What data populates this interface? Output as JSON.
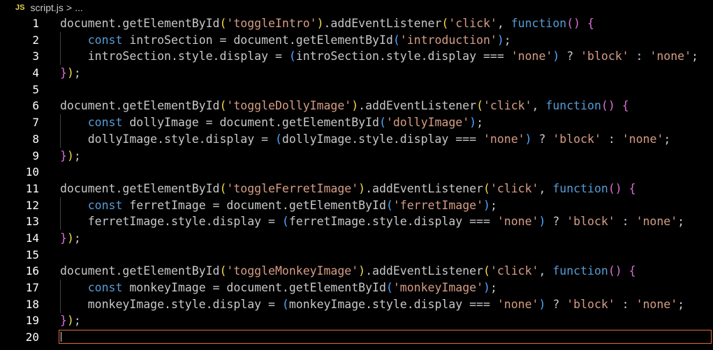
{
  "breadcrumb": {
    "badge": "JS",
    "file": "script.js",
    "separator": ">",
    "more": "..."
  },
  "colors": {
    "background": "#000000",
    "default_text": "#c8c8c8",
    "string": "#d69d85",
    "keyword": "#569cd6",
    "bracket_level_1": "#f5d94a",
    "bracket_level_2": "#da70d6",
    "bracket_level_3": "#4fa6ff",
    "current_line_border": "#e06c3b"
  },
  "editor": {
    "current_line": 20,
    "lines": [
      {
        "n": "1",
        "tokens": [
          {
            "t": "document.getElementById",
            "c": "def"
          },
          {
            "t": "(",
            "c": "p1"
          },
          {
            "t": "'toggleIntro'",
            "c": "str"
          },
          {
            "t": ")",
            "c": "p1"
          },
          {
            "t": ".addEventListener",
            "c": "def"
          },
          {
            "t": "(",
            "c": "p1"
          },
          {
            "t": "'click'",
            "c": "str"
          },
          {
            "t": ", ",
            "c": "def"
          },
          {
            "t": "function",
            "c": "key"
          },
          {
            "t": "()",
            "c": "p2"
          },
          {
            "t": " ",
            "c": "def"
          },
          {
            "t": "{",
            "c": "p2"
          }
        ]
      },
      {
        "n": "2",
        "tokens": [
          {
            "t": "    ",
            "c": "def"
          },
          {
            "t": "const",
            "c": "key"
          },
          {
            "t": " introSection = document.getElementById",
            "c": "def"
          },
          {
            "t": "(",
            "c": "p3"
          },
          {
            "t": "'introduction'",
            "c": "str"
          },
          {
            "t": ")",
            "c": "p3"
          },
          {
            "t": ";",
            "c": "def"
          }
        ]
      },
      {
        "n": "3",
        "tokens": [
          {
            "t": "    introSection.style.display = ",
            "c": "def"
          },
          {
            "t": "(",
            "c": "p3"
          },
          {
            "t": "introSection.style.display === ",
            "c": "def"
          },
          {
            "t": "'none'",
            "c": "str"
          },
          {
            "t": ")",
            "c": "p3"
          },
          {
            "t": " ? ",
            "c": "def"
          },
          {
            "t": "'block'",
            "c": "str"
          },
          {
            "t": " : ",
            "c": "def"
          },
          {
            "t": "'none'",
            "c": "str"
          },
          {
            "t": ";",
            "c": "def"
          }
        ]
      },
      {
        "n": "4",
        "tokens": [
          {
            "t": "}",
            "c": "p2"
          },
          {
            "t": ")",
            "c": "p1"
          },
          {
            "t": ";",
            "c": "def"
          }
        ]
      },
      {
        "n": "5",
        "tokens": []
      },
      {
        "n": "6",
        "tokens": [
          {
            "t": "document.getElementById",
            "c": "def"
          },
          {
            "t": "(",
            "c": "p1"
          },
          {
            "t": "'toggleDollyImage'",
            "c": "str"
          },
          {
            "t": ")",
            "c": "p1"
          },
          {
            "t": ".addEventListener",
            "c": "def"
          },
          {
            "t": "(",
            "c": "p1"
          },
          {
            "t": "'click'",
            "c": "str"
          },
          {
            "t": ", ",
            "c": "def"
          },
          {
            "t": "function",
            "c": "key"
          },
          {
            "t": "()",
            "c": "p2"
          },
          {
            "t": " ",
            "c": "def"
          },
          {
            "t": "{",
            "c": "p2"
          }
        ]
      },
      {
        "n": "7",
        "tokens": [
          {
            "t": "    ",
            "c": "def"
          },
          {
            "t": "const",
            "c": "key"
          },
          {
            "t": " dollyImage = document.getElementById",
            "c": "def"
          },
          {
            "t": "(",
            "c": "p3"
          },
          {
            "t": "'dollyImage'",
            "c": "str"
          },
          {
            "t": ")",
            "c": "p3"
          },
          {
            "t": ";",
            "c": "def"
          }
        ]
      },
      {
        "n": "8",
        "tokens": [
          {
            "t": "    dollyImage.style.display = ",
            "c": "def"
          },
          {
            "t": "(",
            "c": "p3"
          },
          {
            "t": "dollyImage.style.display === ",
            "c": "def"
          },
          {
            "t": "'none'",
            "c": "str"
          },
          {
            "t": ")",
            "c": "p3"
          },
          {
            "t": " ? ",
            "c": "def"
          },
          {
            "t": "'block'",
            "c": "str"
          },
          {
            "t": " : ",
            "c": "def"
          },
          {
            "t": "'none'",
            "c": "str"
          },
          {
            "t": ";",
            "c": "def"
          }
        ]
      },
      {
        "n": "9",
        "tokens": [
          {
            "t": "}",
            "c": "p2"
          },
          {
            "t": ")",
            "c": "p1"
          },
          {
            "t": ";",
            "c": "def"
          }
        ]
      },
      {
        "n": "10",
        "tokens": []
      },
      {
        "n": "11",
        "tokens": [
          {
            "t": "document.getElementById",
            "c": "def"
          },
          {
            "t": "(",
            "c": "p1"
          },
          {
            "t": "'toggleFerretImage'",
            "c": "str"
          },
          {
            "t": ")",
            "c": "p1"
          },
          {
            "t": ".addEventListener",
            "c": "def"
          },
          {
            "t": "(",
            "c": "p1"
          },
          {
            "t": "'click'",
            "c": "str"
          },
          {
            "t": ", ",
            "c": "def"
          },
          {
            "t": "function",
            "c": "key"
          },
          {
            "t": "()",
            "c": "p2"
          },
          {
            "t": " ",
            "c": "def"
          },
          {
            "t": "{",
            "c": "p2"
          }
        ]
      },
      {
        "n": "12",
        "tokens": [
          {
            "t": "    ",
            "c": "def"
          },
          {
            "t": "const",
            "c": "key"
          },
          {
            "t": " ferretImage = document.getElementById",
            "c": "def"
          },
          {
            "t": "(",
            "c": "p3"
          },
          {
            "t": "'ferretImage'",
            "c": "str"
          },
          {
            "t": ")",
            "c": "p3"
          },
          {
            "t": ";",
            "c": "def"
          }
        ]
      },
      {
        "n": "13",
        "tokens": [
          {
            "t": "    ferretImage.style.display = ",
            "c": "def"
          },
          {
            "t": "(",
            "c": "p3"
          },
          {
            "t": "ferretImage.style.display === ",
            "c": "def"
          },
          {
            "t": "'none'",
            "c": "str"
          },
          {
            "t": ")",
            "c": "p3"
          },
          {
            "t": " ? ",
            "c": "def"
          },
          {
            "t": "'block'",
            "c": "str"
          },
          {
            "t": " : ",
            "c": "def"
          },
          {
            "t": "'none'",
            "c": "str"
          },
          {
            "t": ";",
            "c": "def"
          }
        ]
      },
      {
        "n": "14",
        "tokens": [
          {
            "t": "}",
            "c": "p2"
          },
          {
            "t": ")",
            "c": "p1"
          },
          {
            "t": ";",
            "c": "def"
          }
        ]
      },
      {
        "n": "15",
        "tokens": []
      },
      {
        "n": "16",
        "tokens": [
          {
            "t": "document.getElementById",
            "c": "def"
          },
          {
            "t": "(",
            "c": "p1"
          },
          {
            "t": "'toggleMonkeyImage'",
            "c": "str"
          },
          {
            "t": ")",
            "c": "p1"
          },
          {
            "t": ".addEventListener",
            "c": "def"
          },
          {
            "t": "(",
            "c": "p1"
          },
          {
            "t": "'click'",
            "c": "str"
          },
          {
            "t": ", ",
            "c": "def"
          },
          {
            "t": "function",
            "c": "key"
          },
          {
            "t": "()",
            "c": "p2"
          },
          {
            "t": " ",
            "c": "def"
          },
          {
            "t": "{",
            "c": "p2"
          }
        ]
      },
      {
        "n": "17",
        "tokens": [
          {
            "t": "    ",
            "c": "def"
          },
          {
            "t": "const",
            "c": "key"
          },
          {
            "t": " monkeyImage = document.getElementById",
            "c": "def"
          },
          {
            "t": "(",
            "c": "p3"
          },
          {
            "t": "'monkeyImage'",
            "c": "str"
          },
          {
            "t": ")",
            "c": "p3"
          },
          {
            "t": ";",
            "c": "def"
          }
        ]
      },
      {
        "n": "18",
        "tokens": [
          {
            "t": "    monkeyImage.style.display = ",
            "c": "def"
          },
          {
            "t": "(",
            "c": "p3"
          },
          {
            "t": "monkeyImage.style.display === ",
            "c": "def"
          },
          {
            "t": "'none'",
            "c": "str"
          },
          {
            "t": ")",
            "c": "p3"
          },
          {
            "t": " ? ",
            "c": "def"
          },
          {
            "t": "'block'",
            "c": "str"
          },
          {
            "t": " : ",
            "c": "def"
          },
          {
            "t": "'none'",
            "c": "str"
          },
          {
            "t": ";",
            "c": "def"
          }
        ]
      },
      {
        "n": "19",
        "tokens": [
          {
            "t": "}",
            "c": "p2"
          },
          {
            "t": ")",
            "c": "p1"
          },
          {
            "t": ";",
            "c": "def"
          }
        ]
      },
      {
        "n": "20",
        "tokens": []
      }
    ]
  }
}
